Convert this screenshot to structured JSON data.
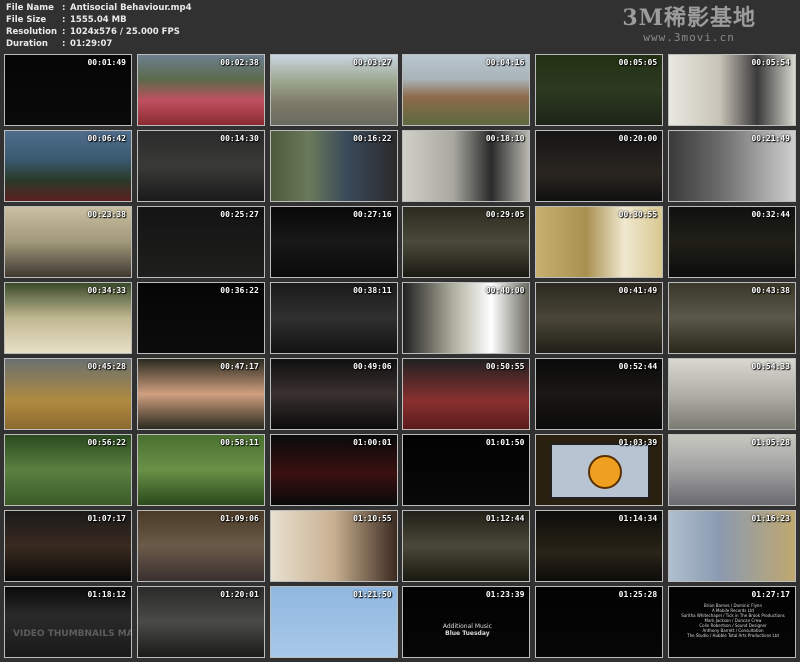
{
  "file_info": {
    "file_name_label": "File Name",
    "file_name": "Antisocial Behaviour.mp4",
    "file_size_label": "File Size",
    "file_size": "1555.04 MB",
    "resolution_label": "Resolution",
    "resolution": "1024x576 / 25.000 FPS",
    "duration_label": "Duration",
    "duration": "01:29:07",
    "separator": ":"
  },
  "brand": {
    "name": "3M稀影基地",
    "url": "www.3movi.cn"
  },
  "thumbnails": [
    {
      "time": "00:01:49",
      "bg": "linear-gradient(#050505,#0a0a0a)"
    },
    {
      "time": "00:02:38",
      "bg": "linear-gradient(180deg,#6d7f90 0%,#5b6a4a 35%,#c05060 65%,#8a2a30 100%)"
    },
    {
      "time": "00:03:27",
      "bg": "linear-gradient(180deg,#c9d6e0 0%,#9aa38a 40%,#7d7868 70%,#6a6a60 100%)"
    },
    {
      "time": "00:04:16",
      "bg": "linear-gradient(180deg,#b9c6cf 0%,#a9b3b8 35%,#8d6a4a 60%,#5d6a3f 100%)"
    },
    {
      "time": "00:05:05",
      "bg": "linear-gradient(180deg,#223014 0%,#2d3a20 50%,#1e2418 100%)"
    },
    {
      "time": "00:05:54",
      "bg": "linear-gradient(90deg,#e8e8e0 0%,#c9c4b8 40%,#3a3a3a 70%,#d8d8d0 100%)"
    },
    {
      "time": "00:06:42",
      "bg": "linear-gradient(180deg,#4f6d8c 0%,#3a5a70 40%,#2a3a2a 70%,#5a2020 100%)"
    },
    {
      "time": "00:14:30",
      "bg": "linear-gradient(180deg,#2a2a2a 0%,#3a3a38 50%,#1a1a1a 100%)"
    },
    {
      "time": "00:16:22",
      "bg": "linear-gradient(90deg,#4a5a3a 0%,#6a7a5a 30%,#3a4a5a 60%,#2a2a2a 100%)"
    },
    {
      "time": "00:18:10",
      "bg": "linear-gradient(90deg,#d0d0c8 0%,#a8a8a0 40%,#2a2a2a 70%,#b8b8b0 100%)"
    },
    {
      "time": "00:20:00",
      "bg": "linear-gradient(180deg,#151515 0%,#2a2520 60%,#101010 100%)"
    },
    {
      "time": "00:21:49",
      "bg": "linear-gradient(90deg,#3a3a3a 0%,#6a6a6a 40%,#d0d0d0 100%)"
    },
    {
      "time": "00:23:38",
      "bg": "linear-gradient(180deg,#c8c0a0 0%,#a09878 50%,#403830 100%)"
    },
    {
      "time": "00:25:27",
      "bg": "linear-gradient(180deg,#141414 0%,#1e1e1c 100%)"
    },
    {
      "time": "00:27:16",
      "bg": "linear-gradient(180deg,#080808 0%,#181818 50%,#0a0a0a 100%)"
    },
    {
      "time": "00:29:05",
      "bg": "linear-gradient(180deg,#2a2a20 0%,#4a4a3a 50%,#1a1a14 100%)"
    },
    {
      "time": "00:30:55",
      "bg": "linear-gradient(90deg,#c8b070 0%,#a89050 40%,#f0e8d0 70%,#d8c890 100%)"
    },
    {
      "time": "00:32:44",
      "bg": "linear-gradient(180deg,#101010 0%,#202018 50%,#0c0c0c 100%)"
    },
    {
      "time": "00:34:33",
      "bg": "linear-gradient(180deg,#3a4a2a 0%,#c0b890 50%,#e8e0c8 100%)"
    },
    {
      "time": "00:36:22",
      "bg": "linear-gradient(180deg,#050505 0%,#0c0c0c 100%)"
    },
    {
      "time": "00:38:11",
      "bg": "linear-gradient(180deg,#1a1a1a 0%,#303030 50%,#121212 100%)"
    },
    {
      "time": "00:40:00",
      "bg": "linear-gradient(90deg,#202020 0%,#b0b0a0 40%,#ffffff 70%,#6a6a60 100%)"
    },
    {
      "time": "00:41:49",
      "bg": "linear-gradient(180deg,#2a2820 0%,#4a4638 50%,#202018 100%)"
    },
    {
      "time": "00:43:38",
      "bg": "linear-gradient(180deg,#3a3828 0%,#5a5848 50%,#2a2818 100%)"
    },
    {
      "time": "00:45:28",
      "bg": "linear-gradient(180deg,#6a7070 0%,#b08a40 60%,#8a6a30 100%)"
    },
    {
      "time": "00:47:17",
      "bg": "linear-gradient(180deg,#2a2a20 0%,#d0a080 50%,#2a2a20 100%)"
    },
    {
      "time": "00:49:06",
      "bg": "linear-gradient(180deg,#101010 0%,#3a3030 50%,#0a0a0a 100%)"
    },
    {
      "time": "00:50:55",
      "bg": "linear-gradient(180deg,#202020 0%,#8a3030 60%,#5a1a1a 100%)"
    },
    {
      "time": "00:52:44",
      "bg": "linear-gradient(180deg,#0a0a0a 0%,#1a1814 50%,#0a0a0a 100%)"
    },
    {
      "time": "00:54:33",
      "bg": "linear-gradient(180deg,#d8d8d0 0%,#b0b0a8 50%,#7a7a70 100%)"
    },
    {
      "time": "00:56:22",
      "bg": "linear-gradient(180deg,#2a4a20 0%,#5a8040 50%,#3a5a28 100%)"
    },
    {
      "time": "00:58:11",
      "bg": "linear-gradient(180deg,#4a7030 0%,#6a9048 50%,#2a4a1a 100%)"
    },
    {
      "time": "01:00:01",
      "bg": "linear-gradient(180deg,#0a0a0a 0%,#3a1010 55%,#0a0a0a 100%)"
    },
    {
      "time": "01:01:50",
      "bg": "linear-gradient(180deg,#020202 0%,#080808 100%)"
    },
    {
      "time": "01:03:39",
      "bg": "#2a2010",
      "tv": true
    },
    {
      "time": "01:05:28",
      "bg": "linear-gradient(180deg,#c8c8c0 0%,#a0a0a0 50%,#6a6a70 100%)"
    },
    {
      "time": "01:07:17",
      "bg": "linear-gradient(180deg,#1a1a1a 0%,#3a2a20 50%,#0a0a0a 100%)"
    },
    {
      "time": "01:09:06",
      "bg": "linear-gradient(180deg,#4a3a28 0%,#6a5a48 50%,#3a3030 100%)"
    },
    {
      "time": "01:10:55",
      "bg": "linear-gradient(90deg,#e8e0d0 0%,#c8b090 50%,#3a2a20 100%)"
    },
    {
      "time": "01:12:44",
      "bg": "linear-gradient(180deg,#202018 0%,#4a4838 50%,#181810 100%)"
    },
    {
      "time": "01:14:34",
      "bg": "linear-gradient(180deg,#0c0c0a 0%,#2a2418 60%,#0c0c0a 100%)"
    },
    {
      "time": "01:16:23",
      "bg": "linear-gradient(90deg,#b0c0d0 0%,#8a9ab0 40%,#c0a870 100%)"
    },
    {
      "time": "01:18:12",
      "bg": "linear-gradient(180deg,#0a0a0a 0%,#2a2a2a 40%,#1a1a1a 100%)",
      "wm": true
    },
    {
      "time": "01:20:01",
      "bg": "linear-gradient(180deg,#2a2a28 0%,#4a4a48 50%,#1a1a18 100%)"
    },
    {
      "time": "01:21:50",
      "bg": "linear-gradient(180deg,#90b8e0 0%,#a8c8e8 100%)"
    },
    {
      "time": "01:23:39",
      "bg": "linear-gradient(180deg,#020202 0%,#060606 100%)",
      "mid": true
    },
    {
      "time": "01:25:28",
      "bg": "linear-gradient(180deg,#020202 0%,#060606 100%)"
    },
    {
      "time": "01:27:17",
      "bg": "linear-gradient(180deg,#020202 0%,#060606 100%)",
      "credits": true
    }
  ],
  "watermark": "VIDEO THUMBNAILS MAKER",
  "mid_credits": {
    "line1": "Additional Music",
    "line2": "Blue Tuesday"
  },
  "credits_text": [
    "Brian Barnes / Dominic Flynn",
    "A Mobile Records Ltd",
    "Saritha Whitechapel / Tick in The Brook Productions",
    "Mark Jackson / Duncan Crew",
    "Colin Robertson / Sound Designer",
    "Anthony Barrett / Consultation",
    "The Studio / Hubble Total Arts Productions Ltd"
  ]
}
